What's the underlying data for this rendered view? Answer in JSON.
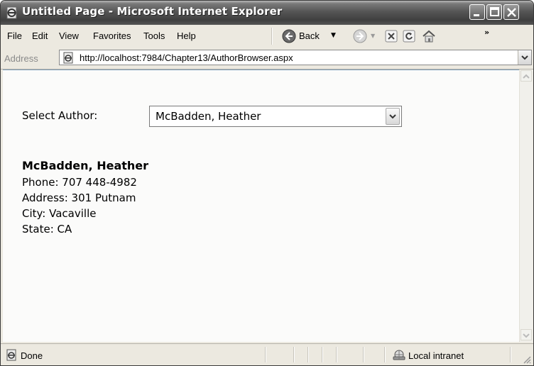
{
  "window": {
    "title": "Untitled Page - Microsoft Internet Explorer"
  },
  "menu": {
    "items": [
      "File",
      "Edit",
      "View",
      "Favorites",
      "Tools",
      "Help"
    ]
  },
  "toolbar": {
    "back_label": "Back",
    "overflow": "»"
  },
  "address": {
    "label": "Address",
    "url": "http://localhost:7984/Chapter13/AuthorBrowser.aspx"
  },
  "page": {
    "select_label": "Select Author:",
    "selected_author": "McBadden, Heather",
    "author": {
      "name": "McBadden, Heather",
      "phone": "Phone: 707 448-4982",
      "address": "Address: 301 Putnam",
      "city": "City: Vacaville",
      "state": "State: CA"
    }
  },
  "status": {
    "text": "Done",
    "zone": "Local intranet"
  },
  "icons": {
    "title": "ie-icon",
    "minimize": "minimize-icon",
    "maximize": "maximize-icon",
    "close": "close-icon",
    "back": "back-arrow-icon",
    "forward": "forward-arrow-icon",
    "stop": "stop-icon",
    "refresh": "refresh-icon",
    "home": "home-icon",
    "windows_logo": "windows-logo-icon",
    "page": "page-icon",
    "intranet": "intranet-icon"
  }
}
